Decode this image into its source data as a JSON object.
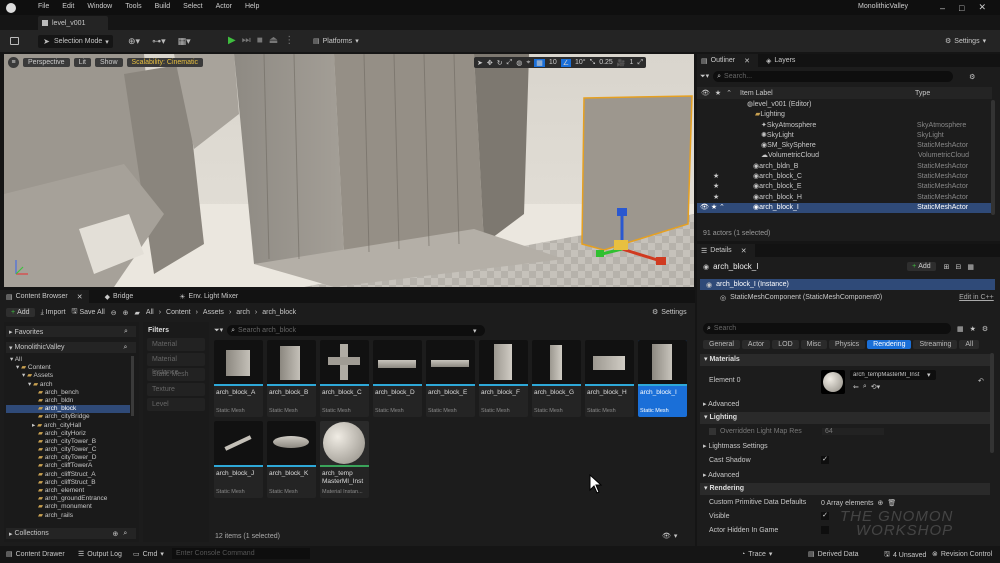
{
  "menu": {
    "items": [
      "File",
      "Edit",
      "Window",
      "Tools",
      "Build",
      "Select",
      "Actor",
      "Help"
    ],
    "project": "MonolithicValley"
  },
  "level_tab": "level_v001",
  "toolbar": {
    "mode": "Selection Mode",
    "platforms": "Platforms",
    "settings": "Settings"
  },
  "viewport": {
    "perspective": "Perspective",
    "lit": "Lit",
    "show": "Show",
    "scalability": "Scalability: Cinematic",
    "grid_snap": "10",
    "rot_snap": "10°",
    "scale_snap": "0.25",
    "cam_speed": "1"
  },
  "outliner": {
    "tab": "Outliner",
    "tab2": "Layers",
    "search_placeholder": "Search...",
    "col_label": "Item Label",
    "col_type": "Type",
    "rows": [
      {
        "label": "level_v001 (Editor)",
        "type": ""
      },
      {
        "label": "Lighting",
        "type": ""
      },
      {
        "label": "SkyAtmosphere",
        "type": "SkyAtmosphere"
      },
      {
        "label": "SkyLight",
        "type": "SkyLight"
      },
      {
        "label": "SM_SkySphere",
        "type": "StaticMeshActor"
      },
      {
        "label": "VolumetricCloud",
        "type": "VolumetricCloud"
      },
      {
        "label": "arch_bldn_B",
        "type": "StaticMeshActor"
      },
      {
        "label": "arch_block_C",
        "type": "StaticMeshActor"
      },
      {
        "label": "arch_block_E",
        "type": "StaticMeshActor"
      },
      {
        "label": "arch_block_H",
        "type": "StaticMeshActor"
      },
      {
        "label": "arch_block_I",
        "type": "StaticMeshActor"
      }
    ],
    "status": "91 actors (1 selected)"
  },
  "details": {
    "tab": "Details",
    "actor": "arch_block_I",
    "add": "Add",
    "instance": "arch_block_I (Instance)",
    "component": "StaticMeshComponent (StaticMeshComponent0)",
    "edit_cpp": "Edit in C++",
    "search_placeholder": "Search",
    "tabs": [
      "General",
      "Actor",
      "LOD",
      "Misc",
      "Physics",
      "Rendering",
      "Streaming",
      "All"
    ],
    "materials": "Materials",
    "element0": "Element 0",
    "material_name": "arch_tempMasterMI_Inst",
    "advanced": "Advanced",
    "lighting": "Lighting",
    "override_lightmap": "Overridden Light Map Res",
    "lightmap_val": "64",
    "lightmass": "Lightmass Settings",
    "cast_shadow": "Cast Shadow",
    "advanced2": "Advanced",
    "rendering": "Rendering",
    "custom_prim": "Custom Primitive Data Defaults",
    "array_elems": "0 Array elements",
    "visible": "Visible",
    "actor_hidden": "Actor Hidden In Game"
  },
  "content": {
    "tabs": [
      "Content Browser",
      "Bridge",
      "Env. Light Mixer"
    ],
    "add": "Add",
    "import": "Import",
    "save_all": "Save All",
    "path": [
      "All",
      "Content",
      "Assets",
      "arch",
      "arch_block"
    ],
    "settings": "Settings",
    "favorites": "Favorites",
    "project": "MonolithicValley",
    "tree": [
      "All",
      "Content",
      "Assets",
      "arch",
      "arch_bench",
      "arch_bldn",
      "arch_block",
      "arch_cityBridge",
      "arch_cityHall",
      "arch_cityHoriz",
      "arch_cityTower_B",
      "arch_cityTower_C",
      "arch_cityTower_D",
      "arch_cliffTowerA",
      "arch_cliffStruct_A",
      "arch_cliffStruct_B",
      "arch_element",
      "arch_groundEntrance",
      "arch_monument",
      "arch_rails"
    ],
    "collections": "Collections",
    "filters": "Filters",
    "filter_items": [
      "Material",
      "Material Instance",
      "Static Mesh",
      "Texture",
      "Level"
    ],
    "search_placeholder": "Search arch_block",
    "assets": [
      {
        "name": "arch_block_A",
        "type": "Static Mesh"
      },
      {
        "name": "arch_block_B",
        "type": "Static Mesh"
      },
      {
        "name": "arch_block_C",
        "type": "Static Mesh"
      },
      {
        "name": "arch_block_D",
        "type": "Static Mesh"
      },
      {
        "name": "arch_block_E",
        "type": "Static Mesh"
      },
      {
        "name": "arch_block_F",
        "type": "Static Mesh"
      },
      {
        "name": "arch_block_G",
        "type": "Static Mesh"
      },
      {
        "name": "arch_block_H",
        "type": "Static Mesh"
      },
      {
        "name": "arch_block_I",
        "type": "Static Mesh"
      },
      {
        "name": "arch_block_J",
        "type": "Static Mesh"
      },
      {
        "name": "arch_block_K",
        "type": "Static Mesh"
      },
      {
        "name": "arch_temp MasterMI_Inst",
        "type": "Material Instan..."
      }
    ],
    "count": "12 items (1 selected)"
  },
  "status": {
    "drawer": "Content Drawer",
    "output": "Output Log",
    "cmd": "Cmd",
    "console_placeholder": "Enter Console Command",
    "trace": "Trace",
    "derived": "Derived Data",
    "unsaved": "4 Unsaved",
    "revision": "Revision Control"
  },
  "watermark": {
    "line1": "THE GNOMON",
    "line2": "WORKSHOP"
  },
  "colors": {
    "accent": "#1a6fd8",
    "selected_row": "#2f4a78",
    "scalability": "#e8c040",
    "play": "#3fbf3f"
  }
}
